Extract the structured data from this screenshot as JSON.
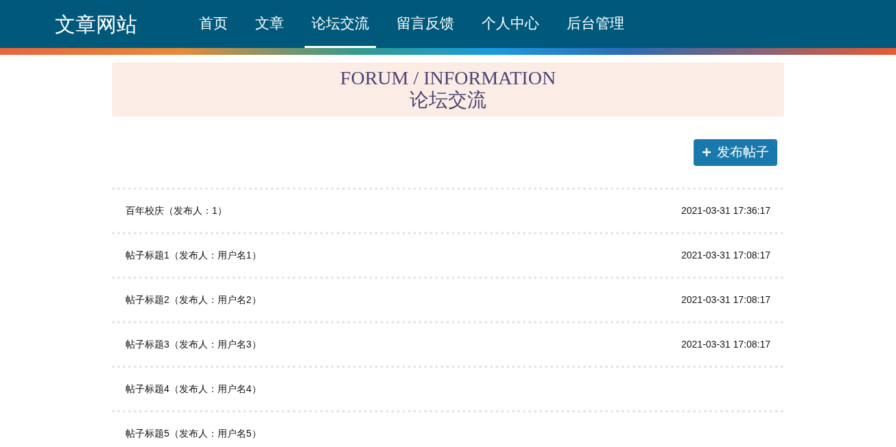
{
  "site_title": "文章网站",
  "nav": [
    {
      "label": "首页",
      "selected": false
    },
    {
      "label": "文章",
      "selected": false
    },
    {
      "label": "论坛交流",
      "selected": true
    },
    {
      "label": "留言反馈",
      "selected": false
    },
    {
      "label": "个人中心",
      "selected": false
    },
    {
      "label": "后台管理",
      "selected": false
    }
  ],
  "banner": {
    "title": "FORUM / INFORMATION",
    "subtitle": "论坛交流"
  },
  "post_button": "发布帖子",
  "posts": [
    {
      "title": "百年校庆（发布人：1）",
      "date": "2021-03-31 17:36:17"
    },
    {
      "title": "帖子标题1（发布人：用户名1）",
      "date": "2021-03-31 17:08:17"
    },
    {
      "title": "帖子标题2（发布人：用户名2）",
      "date": "2021-03-31 17:08:17"
    },
    {
      "title": "帖子标题3（发布人：用户名3）",
      "date": "2021-03-31 17:08:17"
    },
    {
      "title": "帖子标题4（发布人：用户名4）"
    },
    {
      "title": "帖子标题5（发布人：用户名5）"
    }
  ]
}
